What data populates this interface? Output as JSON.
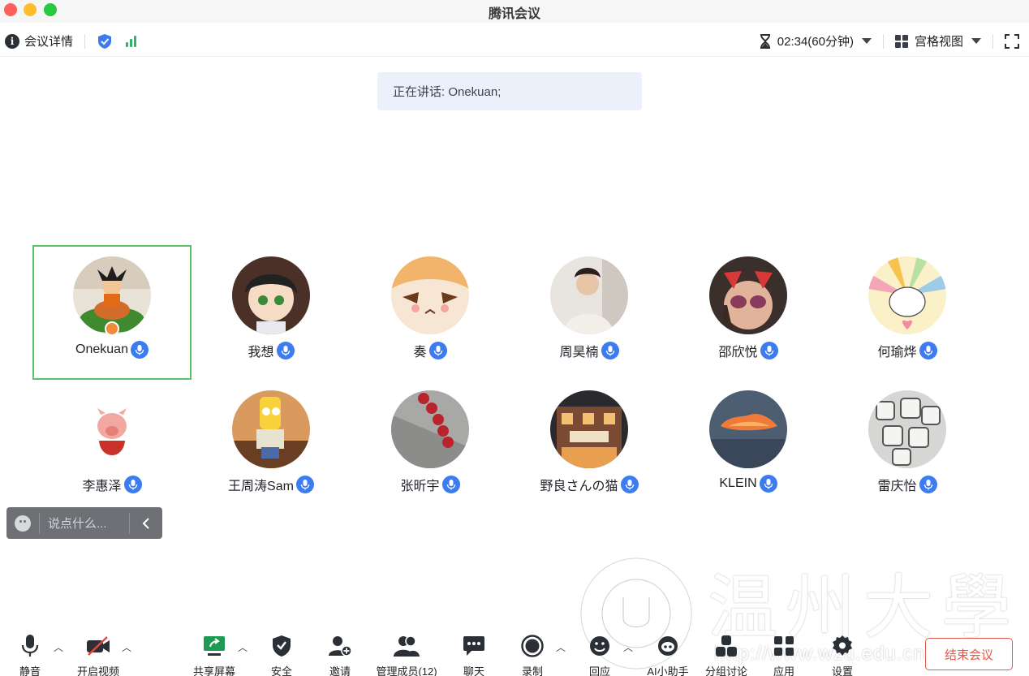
{
  "window": {
    "title": "腾讯会议"
  },
  "infobar": {
    "details_label": "会议详情",
    "timer": "02:34(60分钟)",
    "view_label": "宫格视图"
  },
  "speaker_banner": "正在讲话: Onekuan;",
  "participants": [
    {
      "name": "Onekuan",
      "active": true
    },
    {
      "name": "我想"
    },
    {
      "name": "奏"
    },
    {
      "name": "周昊楠"
    },
    {
      "name": "邵欣悦"
    },
    {
      "name": "何瑜烨"
    },
    {
      "name": "李惠泽"
    },
    {
      "name": "王周涛Sam"
    },
    {
      "name": "张昕宇"
    },
    {
      "name": "野良さんの猫"
    },
    {
      "name": "KLEIN"
    },
    {
      "name": "雷庆怡"
    }
  ],
  "chat": {
    "placeholder": "说点什么..."
  },
  "toolbar": {
    "mute": "静音",
    "video": "开启视频",
    "share": "共享屏幕",
    "security": "安全",
    "invite": "邀请",
    "members": "管理成员(12)",
    "chat": "聊天",
    "record": "录制",
    "react": "回应",
    "ai": "AI小助手",
    "breakout": "分组讨论",
    "apps": "应用",
    "settings": "设置",
    "end": "结束会议"
  },
  "watermark": {
    "text": "温州大學",
    "url": "http://www.wzu.edu.cn"
  }
}
